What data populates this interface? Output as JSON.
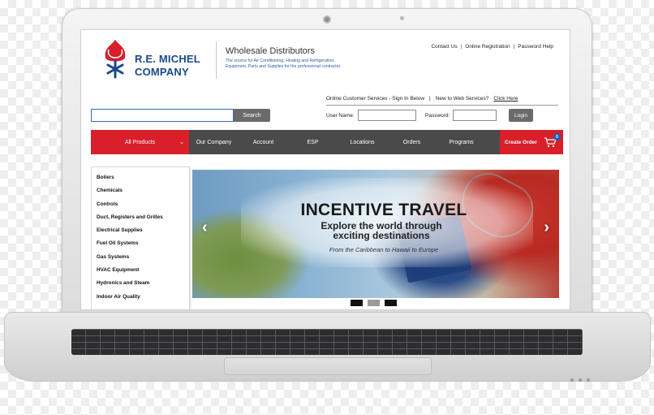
{
  "header": {
    "brand_line1": "R.E. MICHEL",
    "brand_line2": "COMPANY",
    "title": "Wholesale Distributors",
    "tagline": "The source for Air Conditioning, Heating and Refrigeration, Equipment, Parts and Supplies for the professional contractor.",
    "links": [
      "Contact Us",
      "Online Registration",
      "Password Help"
    ]
  },
  "search": {
    "placeholder": "",
    "button_label": "Search"
  },
  "signin": {
    "heading": "Online Customer Services - Sign In Below",
    "new_text": "New to Web Services?",
    "click_here": "Click Here",
    "username_label": "User Name:",
    "password_label": "Password:",
    "login_label": "Login"
  },
  "nav": {
    "all_products": "All Products",
    "chevron": "⌄",
    "items": [
      "Our Company",
      "Account",
      "ESP",
      "Locations",
      "Orders",
      "Programs"
    ],
    "create_order": "Create Order",
    "cart_count": "0"
  },
  "categories": [
    "Boilers",
    "Chemicals",
    "Controls",
    "Duct, Registers and Grilles",
    "Electrical Supplies",
    "Fuel Oil Systems",
    "Gas Systems",
    "HVAC Equipment",
    "Hydronics and Steam",
    "Indoor Air Quality"
  ],
  "banner": {
    "title": "INCENTIVE TRAVEL",
    "subtitle_line1": "Explore the world through",
    "subtitle_line2": "exciting destinations",
    "small": "From the Caribbean to Hawaii to Europe",
    "prev": "‹",
    "next": "›",
    "active_slide": 2,
    "slide_count": 3
  },
  "colors": {
    "accent_red": "#d81f2a",
    "nav_gray": "#4a4a4a",
    "brand_blue": "#1b4a8a"
  }
}
